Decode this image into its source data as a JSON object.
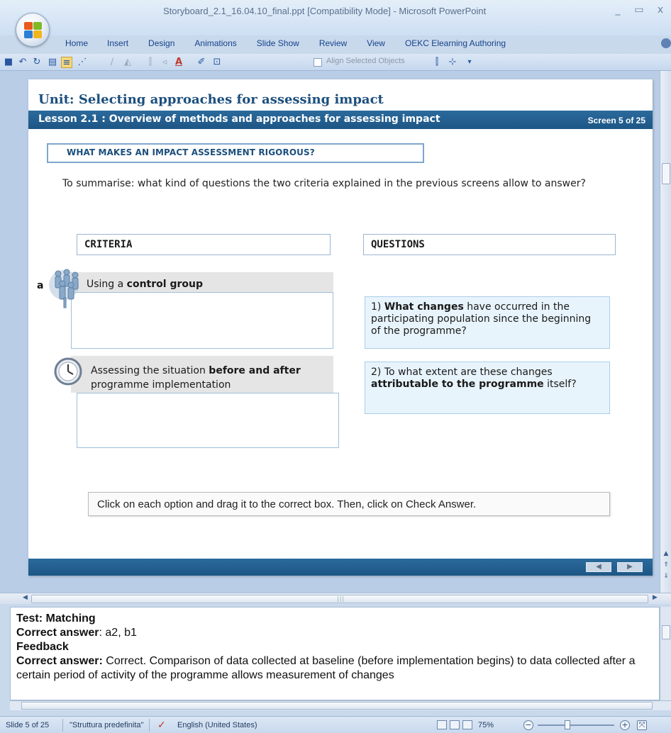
{
  "window": {
    "title": "Storyboard_2.1_16.04.10_final.ppt [Compatibility Mode] - Microsoft PowerPoint",
    "controls": [
      "_",
      "▭",
      "x"
    ]
  },
  "ribbon": {
    "tabs": [
      "Home",
      "Insert",
      "Design",
      "Animations",
      "Slide Show",
      "Review",
      "View",
      "OEKC Elearning Authoring"
    ]
  },
  "toolbar": {
    "align_selected_objects": "Align Selected Objects"
  },
  "slide": {
    "unit_title": "Unit: Selecting approaches for assessing impact",
    "lesson_title": "Lesson 2.1 : Overview of methods and approaches for assessing impact",
    "screen_counter": "Screen 5 of 25",
    "heading": "WHAT MAKES AN IMPACT ASSESSMENT RIGOROUS?",
    "intro": "To summarise: what kind of questions the two criteria explained in the previous screens allow to answer?",
    "criteria_header": "CRITERIA",
    "questions_header": "QUESTIONS",
    "criterion_a": {
      "letter": "a",
      "text_pre": "Using a ",
      "text_bold": "control group"
    },
    "criterion_b": {
      "text_pre": "Assessing the situation ",
      "text_bold": "before and after",
      "text_post": " programme implementation"
    },
    "question_1": {
      "num": "1) ",
      "bold": "What changes",
      "rest": " have occurred in the participating population since the beginning of the programme?"
    },
    "question_2": {
      "pre": "2) To what extent are these changes ",
      "bold": "attributable to the programme",
      "post": " itself?"
    },
    "instruction": "Click on each option and drag it to the correct box. Then, click on Check Answer.",
    "nav_prev": "◀",
    "nav_next": "▶"
  },
  "notes": {
    "test_label": "Test: Matching",
    "correct_answer_label": "Correct answer",
    "correct_answer_value": ": a2, b1",
    "feedback_label": "Feedback",
    "feedback_correct_label": "Correct answer:",
    "feedback_text": " Correct. Comparison of data collected at baseline (before implementation begins) to data collected after a certain period of activity of the programme allows measurement  of changes"
  },
  "statusbar": {
    "slide_info": "Slide 5 of 25",
    "theme": "\"Struttura predefinita\"",
    "language": "English (United States)",
    "zoom": "75%"
  },
  "colors": {
    "lesson_bar": "#1f5a88",
    "title_blue": "#1b4f7d",
    "question_bg": "#e8f4fc"
  }
}
